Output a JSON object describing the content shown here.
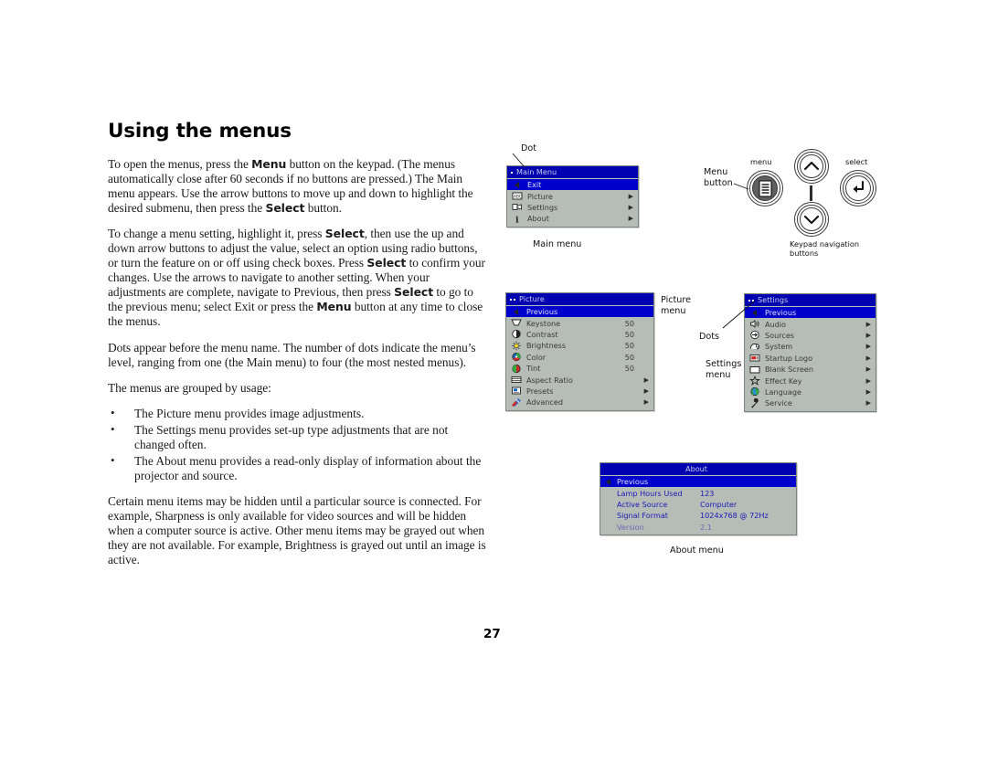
{
  "page": {
    "title": "Using the menus",
    "number": "27"
  },
  "body": {
    "paragraphs": [
      {
        "id": "p1",
        "runs": [
          {
            "t": "To open the menus, press the ",
            "b": false
          },
          {
            "t": "Menu",
            "b": true
          },
          {
            "t": " button on the keypad. (The menus automatically close after 60 seconds if no buttons are pressed.) The Main menu appears. Use the arrow buttons to move up and down to highlight the desired submenu, then press the ",
            "b": false
          },
          {
            "t": "Select",
            "b": true
          },
          {
            "t": " button.",
            "b": false
          }
        ]
      },
      {
        "id": "p2",
        "runs": [
          {
            "t": "To change a menu setting, highlight it, press ",
            "b": false
          },
          {
            "t": "Select",
            "b": true
          },
          {
            "t": ", then use the up and down arrow buttons to adjust the value, select an option using radio buttons, or turn the feature on or off using check boxes. Press ",
            "b": false
          },
          {
            "t": "Select",
            "b": true
          },
          {
            "t": " to confirm your changes. Use the arrows to navigate to another setting. When your adjustments are complete, navigate to Previous, then press ",
            "b": false
          },
          {
            "t": "Select",
            "b": true
          },
          {
            "t": " to go to the previous menu; select Exit or press the ",
            "b": false
          },
          {
            "t": "Menu",
            "b": true
          },
          {
            "t": " button at any time to close the menus.",
            "b": false
          }
        ]
      },
      {
        "id": "p3",
        "runs": [
          {
            "t": "Dots appear before the menu name. The number of dots indicate the menu’s level, ranging from one (the Main menu) to four (the most nested menus).",
            "b": false
          }
        ]
      },
      {
        "id": "p4",
        "runs": [
          {
            "t": "The menus are grouped by usage:",
            "b": false
          }
        ]
      }
    ],
    "bullets": [
      "The Picture menu provides image adjustments.",
      "The Settings menu provides set-up type adjustments that are not changed often.",
      "The About menu provides a read-only display of information about the projector and source."
    ],
    "closing_paragraph": "Certain menu items may be hidden until a particular source is connected. For example, Sharpness is only available for video sources and will be hidden when a computer source is active. Other menu items may be grayed out when they are not available. For example, Brightness is grayed out until an image is active."
  },
  "callouts": {
    "dot": "Dot",
    "main_menu": "Main menu",
    "picture_menu": "Picture\nmenu",
    "dots": "Dots",
    "settings_menu": "Settings\nmenu",
    "about_menu": "About menu",
    "menu_button": "Menu\nbutton",
    "menu_label": "menu",
    "select_label": "select",
    "keypad_nav": "Keypad navigation\nbuttons"
  },
  "osd": {
    "colors": {
      "title_bar": "#0000b0",
      "highlight": "#0000cc",
      "body": "#b6bcb6",
      "value_text": "#1b1bb8"
    },
    "main_menu": {
      "title": "Main Menu",
      "dots": 1,
      "rows": [
        {
          "icon": "back-arrow-icon",
          "label": "Exit",
          "value": "",
          "arrow": "",
          "selected": true
        },
        {
          "icon": "picture-icon",
          "label": "Picture",
          "value": "",
          "arrow": "▶",
          "selected": false
        },
        {
          "icon": "settings-icon",
          "label": "Settings",
          "value": "",
          "arrow": "▶",
          "selected": false
        },
        {
          "icon": "about-info-icon",
          "label": "About",
          "value": "",
          "arrow": "▶",
          "selected": false
        }
      ]
    },
    "picture_menu": {
      "title": "Picture",
      "dots": 2,
      "rows": [
        {
          "icon": "back-arrow-icon",
          "label": "Previous",
          "value": "",
          "arrow": "",
          "selected": true
        },
        {
          "icon": "keystone-icon",
          "label": "Keystone",
          "value": "50",
          "arrow": "",
          "selected": false
        },
        {
          "icon": "contrast-icon",
          "label": "Contrast",
          "value": "50",
          "arrow": "",
          "selected": false
        },
        {
          "icon": "brightness-icon",
          "label": "Brightness",
          "value": "50",
          "arrow": "",
          "selected": false
        },
        {
          "icon": "color-icon",
          "label": "Color",
          "value": "50",
          "arrow": "",
          "selected": false
        },
        {
          "icon": "tint-icon",
          "label": "Tint",
          "value": "50",
          "arrow": "",
          "selected": false
        },
        {
          "icon": "aspect-ratio-icon",
          "label": "Aspect Ratio",
          "value": "",
          "arrow": "▶",
          "selected": false
        },
        {
          "icon": "presets-icon",
          "label": "Presets",
          "value": "",
          "arrow": "▶",
          "selected": false
        },
        {
          "icon": "advanced-icon",
          "label": "Advanced",
          "value": "",
          "arrow": "▶",
          "selected": false
        }
      ]
    },
    "settings_menu": {
      "title": "Settings",
      "dots": 2,
      "rows": [
        {
          "icon": "back-arrow-icon",
          "label": "Previous",
          "value": "",
          "arrow": "",
          "selected": true
        },
        {
          "icon": "audio-speaker-icon",
          "label": "Audio",
          "value": "",
          "arrow": "▶",
          "selected": false
        },
        {
          "icon": "sources-icon",
          "label": "Sources",
          "value": "",
          "arrow": "▶",
          "selected": false
        },
        {
          "icon": "system-icon",
          "label": "System",
          "value": "",
          "arrow": "▶",
          "selected": false
        },
        {
          "icon": "startup-logo-icon",
          "label": "Startup Logo",
          "value": "",
          "arrow": "▶",
          "selected": false
        },
        {
          "icon": "blank-screen-icon",
          "label": "Blank Screen",
          "value": "",
          "arrow": "▶",
          "selected": false
        },
        {
          "icon": "effect-key-star-icon",
          "label": "Effect Key",
          "value": "",
          "arrow": "▶",
          "selected": false
        },
        {
          "icon": "language-globe-icon",
          "label": "Language",
          "value": "",
          "arrow": "▶",
          "selected": false
        },
        {
          "icon": "service-wrench-icon",
          "label": "Service",
          "value": "",
          "arrow": "▶",
          "selected": false
        }
      ]
    },
    "about_menu": {
      "title": "About",
      "dots": 0,
      "rows": [
        {
          "icon": "back-arrow-icon",
          "label": "Previous",
          "value": "",
          "selected": true,
          "dim": false
        },
        {
          "icon": "",
          "label": "Lamp Hours Used",
          "value": "123",
          "selected": false,
          "dim": false
        },
        {
          "icon": "",
          "label": "Active Source",
          "value": "Computer",
          "selected": false,
          "dim": false
        },
        {
          "icon": "",
          "label": "Signal Format",
          "value": "1024x768 @ 72Hz",
          "selected": false,
          "dim": false
        },
        {
          "icon": "",
          "label": "Version",
          "value": "2.1",
          "selected": false,
          "dim": true
        }
      ]
    }
  },
  "keypad": {
    "buttons": [
      {
        "name": "menu-button",
        "glyph": "menu-lines-icon"
      },
      {
        "name": "up-button",
        "glyph": "chevron-up-icon"
      },
      {
        "name": "down-button",
        "glyph": "chevron-down-icon"
      },
      {
        "name": "select-button",
        "glyph": "enter-arrow-icon"
      }
    ]
  }
}
